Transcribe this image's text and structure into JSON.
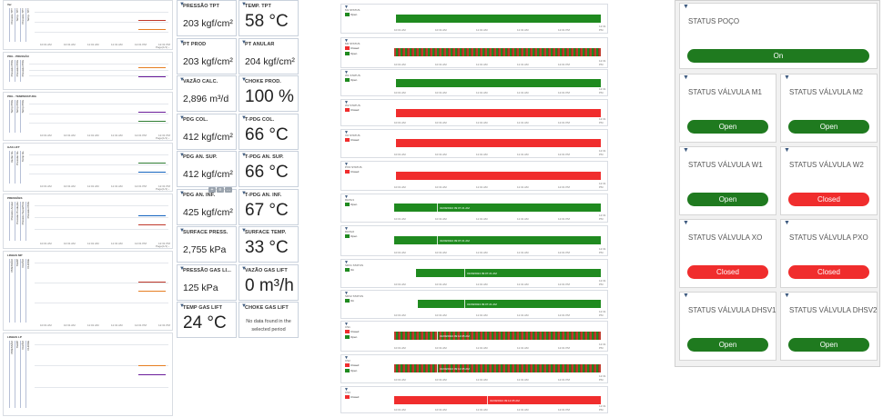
{
  "charts": {
    "panels": [
      {
        "title": "Ver",
        "labels": [
          "Pressão TPT",
          "Temp. TPT",
          "Pressão TPT",
          "Temp. TPT"
        ],
        "ticks": [
          "10:01 AM",
          "10:31 AM",
          "11:01 AM",
          "11:31 AM",
          "12:01 PM",
          "12:31 PM"
        ],
        "footer": "Page(1/1) ›"
      },
      {
        "title": "PDG - PRESSÃO",
        "labels": [
          "Pressão PDG",
          "Pressão PDG",
          "Pressão PDG"
        ],
        "ticks": [],
        "footer": ""
      },
      {
        "title": "PDG - TEMPERATURA",
        "labels": [
          "Temp PDG",
          "Temp PDG",
          "Temp PDG"
        ],
        "ticks": [
          "10:01 AM",
          "10:31 AM",
          "11:01 AM",
          "11:31 AM",
          "12:01 PM",
          "12:31 PM"
        ],
        "footer": "Page(1/1) ›"
      },
      {
        "title": "GAS LIFT",
        "labels": [
          "Vazão GL",
          "Pressão GL",
          "Temp GL"
        ],
        "ticks": [
          "10:01 AM",
          "10:31 AM",
          "11:01 AM",
          "11:31 AM",
          "12:01 PM",
          "12:31 PM"
        ],
        "footer": "Page(1/1) ›"
      },
      {
        "title": "PRESSÕES",
        "labels": [
          "Pressão Anular",
          "Pressão Produção",
          "Pressão Superfície",
          "Pressão PDG"
        ],
        "ticks": [
          "10:01 AM",
          "10:31 AM",
          "11:01 AM",
          "11:31 AM",
          "12:01 PM",
          "12:31 PM"
        ],
        "footer": "Page(1/1) ›"
      },
      {
        "title": "LINHAS MP",
        "labels": [
          "PRESSÃO",
          "TEMP",
          "VAZÃO",
          "CHOKE"
        ],
        "ticks": [
          "10:01 AM",
          "10:31 AM",
          "11:01 AM",
          "11:31 AM",
          "12:01 PM",
          "12:31 PM"
        ],
        "footer": ""
      },
      {
        "title": "LINHAS LP",
        "labels": [
          "PRESSÃO",
          "TEMP",
          "VAZÃO",
          "CHOKE"
        ],
        "ticks": [],
        "footer": ""
      }
    ]
  },
  "tiles": [
    {
      "label": "PRESSÃO TPT",
      "value": "203 kgf/cm²",
      "big": false
    },
    {
      "label": "TEMP. TPT",
      "value": "58 °C",
      "big": true
    },
    {
      "label": "PT PROD",
      "value": "203 kgf/cm²",
      "big": false
    },
    {
      "label": "PT ANULAR",
      "value": "204 kgf/cm²",
      "big": false
    },
    {
      "label": "VAZÃO CALC.",
      "value": "2,896 m³/d",
      "big": false
    },
    {
      "label": "CHOKE PROD.",
      "value": "100 %",
      "big": true
    },
    {
      "label": "PDG COL.",
      "value": "412 kgf/cm²",
      "big": false
    },
    {
      "label": "T-PDG COL.",
      "value": "66 °C",
      "big": true
    },
    {
      "label": "PDG AN. SUP.",
      "value": "412 kgf/cm²",
      "big": false
    },
    {
      "label": "T-PDG AN. SUP.",
      "value": "66 °C",
      "big": true
    },
    {
      "label": "PDG AN. INF.",
      "value": "425 kgf/cm²",
      "big": false
    },
    {
      "label": "T-PDG AN. INF.",
      "value": "67 °C",
      "big": true
    },
    {
      "label": "SURFACE PRESS.",
      "value": "2,755 kPa",
      "big": false
    },
    {
      "label": "SURFACE TEMP.",
      "value": "33 °C",
      "big": true
    },
    {
      "label": "PRESSÃO GAS LI...",
      "value": "125 kPa",
      "big": false
    },
    {
      "label": "VAZÃO GAS LIFT",
      "value": "0 m³/h",
      "big": true
    },
    {
      "label": "TEMP GAS LIFT",
      "value": "24 °C",
      "big": true
    },
    {
      "label": "CHOKE GAS LIFT",
      "value": "",
      "nodata": "No data found in the selected period",
      "big": false
    }
  ],
  "timelines": {
    "ticks": [
      "10:01 AM",
      "10:31 AM",
      "11:01 AM",
      "11:31 AM",
      "12:01 PM",
      "12:31 PM"
    ],
    "rows": [
      {
        "title": "M1 STATUS",
        "legend": [
          {
            "color": "#1f8a1f",
            "text": "Open"
          }
        ],
        "bars": [
          {
            "c": "#1f8a1f"
          }
        ],
        "label": ""
      },
      {
        "title": "M2 STATUS",
        "legend": [
          {
            "color": "#f02d2d",
            "text": "Closed"
          },
          {
            "color": "#1f8a1f",
            "text": "Open"
          }
        ],
        "bars": [
          {
            "c": "stripe"
          }
        ],
        "label": ""
      },
      {
        "title": "W1 STATUS",
        "legend": [
          {
            "color": "#1f8a1f",
            "text": "Open"
          }
        ],
        "bars": [
          {
            "c": "#1f8a1f"
          }
        ],
        "label": ""
      },
      {
        "title": "W2 STATUS",
        "legend": [
          {
            "color": "#f02d2d",
            "text": "Closed"
          }
        ],
        "bars": [
          {
            "c": "#f02d2d"
          }
        ],
        "label": ""
      },
      {
        "title": "XO STATUS",
        "legend": [
          {
            "color": "#f02d2d",
            "text": "Closed"
          }
        ],
        "bars": [
          {
            "c": "#f02d2d"
          }
        ],
        "label": ""
      },
      {
        "title": "PXO STATUS",
        "legend": [
          {
            "color": "#f02d2d",
            "text": "Closed"
          }
        ],
        "bars": [
          {
            "c": "#f02d2d"
          }
        ],
        "label": ""
      },
      {
        "title": "DHSV1",
        "legend": [
          {
            "color": "#1f8a1f",
            "text": "Open"
          }
        ],
        "bars": [
          {
            "c": "#1f8a1f"
          }
        ],
        "label": "01/09/2024 09:07:21 AM"
      },
      {
        "title": "DHSV2",
        "legend": [
          {
            "color": "#1f8a1f",
            "text": "Open"
          }
        ],
        "bars": [
          {
            "c": "#1f8a1f"
          }
        ],
        "label": "01/09/2024 09:07:21 AM"
      },
      {
        "title": "SDV1 STATUS",
        "legend": [
          {
            "color": "#1f8a1f",
            "text": "On"
          }
        ],
        "bars": [
          {
            "c": "#1f8a1f"
          }
        ],
        "label": "01/09/2024 09:07:21 AM"
      },
      {
        "title": "SDV2 STATUS",
        "legend": [
          {
            "color": "#1f8a1f",
            "text": "On"
          }
        ],
        "bars": [
          {
            "c": "#1f8a1f"
          }
        ],
        "label": "01/09/2024 09:07:21 AM"
      },
      {
        "title": "CS1",
        "legend": [
          {
            "color": "#f02d2d",
            "text": "Closed"
          },
          {
            "color": "#1f8a1f",
            "text": "Open"
          }
        ],
        "bars": [
          {
            "c": "stripe"
          }
        ],
        "label": "01/09/2024 09:12:05 AM"
      },
      {
        "title": "CS2",
        "legend": [
          {
            "color": "#f02d2d",
            "text": "Closed"
          },
          {
            "color": "#1f8a1f",
            "text": "Open"
          }
        ],
        "bars": [
          {
            "c": "stripe"
          }
        ],
        "label": "01/09/2024 09:12:05 AM"
      },
      {
        "title": "CS3",
        "legend": [
          {
            "color": "#f02d2d",
            "text": "Closed"
          }
        ],
        "bars": [
          {
            "c": "#f02d2d"
          }
        ],
        "label": "01/09/2024 09:12:05 AM"
      }
    ]
  },
  "status_cards": {
    "poco": {
      "title": "STATUS POÇO",
      "state": "On",
      "kind": "on"
    },
    "items": [
      {
        "title": "STATUS VÁLVULA M1",
        "state": "Open",
        "kind": "on"
      },
      {
        "title": "STATUS VÁLVULA M2",
        "state": "Open",
        "kind": "on"
      },
      {
        "title": "STATUS VÁLVULA W1",
        "state": "Open",
        "kind": "on"
      },
      {
        "title": "STATUS VÁLVULA W2",
        "state": "Closed",
        "kind": "off"
      },
      {
        "title": "STATUS VÁLVULA XO",
        "state": "Closed",
        "kind": "off"
      },
      {
        "title": "STATUS VÁLVULA PXO",
        "state": "Closed",
        "kind": "off"
      },
      {
        "title": "STATUS VÁLVULA DHSV1",
        "state": "Open",
        "kind": "on"
      },
      {
        "title": "STATUS VÁLVULA DHSV2",
        "state": "Open",
        "kind": "on"
      }
    ]
  },
  "colors": {
    "open": "#1f7a1f",
    "closed": "#f02d2d",
    "accent": "#3d5a7f"
  }
}
